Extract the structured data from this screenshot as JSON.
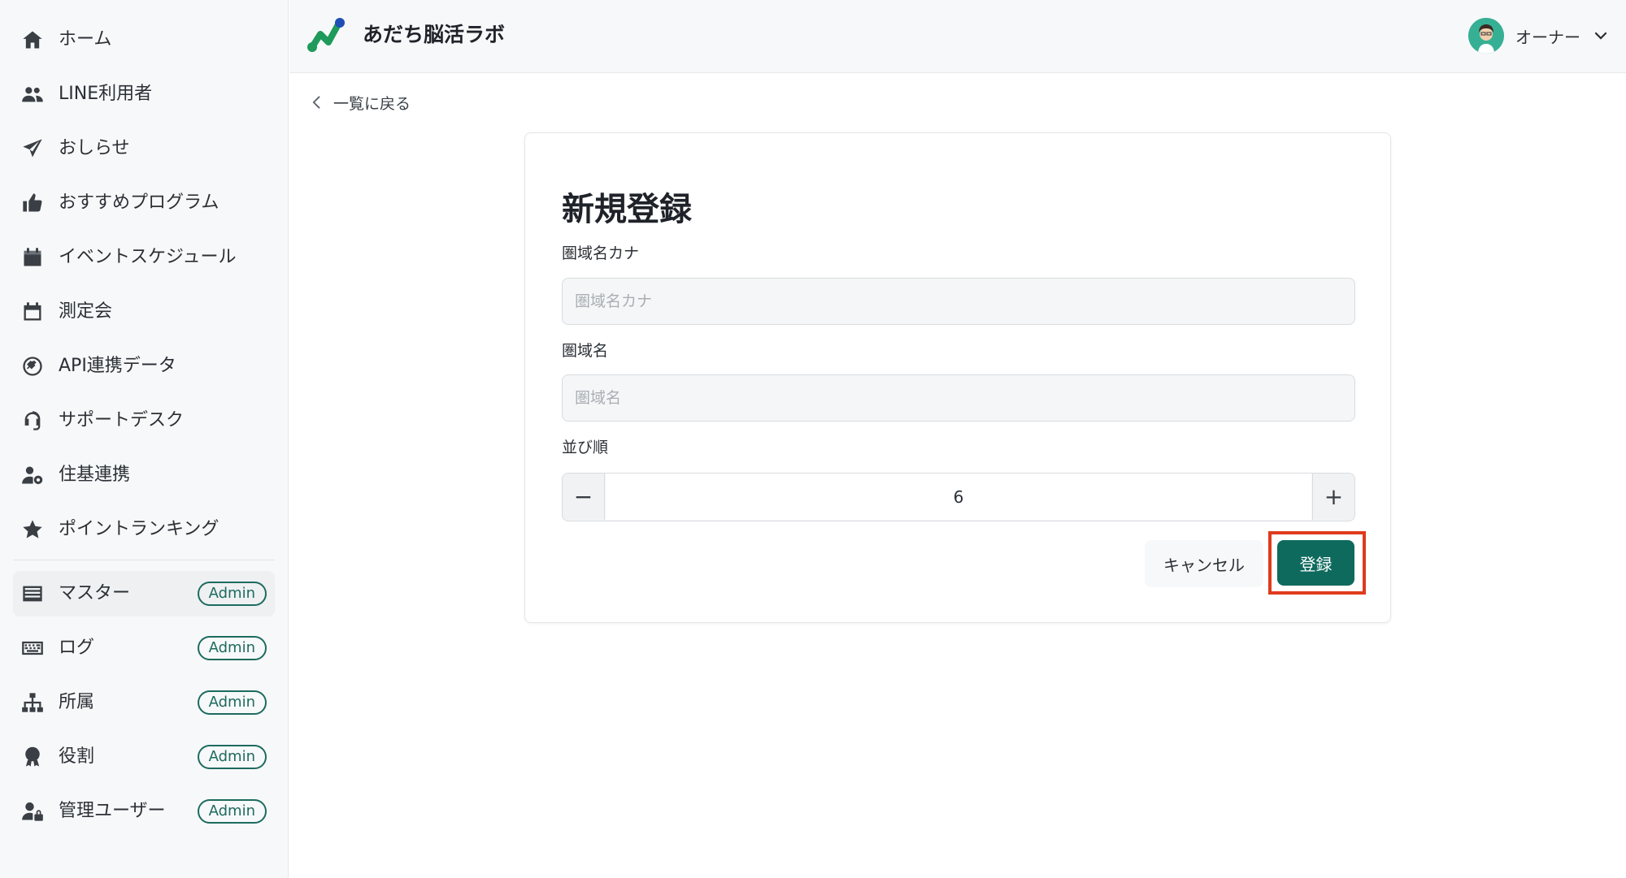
{
  "colors": {
    "accent": "#0f6a5e",
    "badge": "#1d6b5f",
    "highlight": "#e03a1e",
    "sidebar_bg": "#f7f8f9"
  },
  "sidebar": {
    "items": [
      {
        "label": "ホーム",
        "icon": "home-icon"
      },
      {
        "label": "LINE利用者",
        "icon": "users-icon"
      },
      {
        "label": "おしらせ",
        "icon": "paper-plane-icon"
      },
      {
        "label": "おすすめプログラム",
        "icon": "thumbs-up-icon"
      },
      {
        "label": "イベントスケジュール",
        "icon": "calendar-icon"
      },
      {
        "label": "測定会",
        "icon": "calendar-outline-icon"
      },
      {
        "label": "API連携データ",
        "icon": "plug-icon"
      },
      {
        "label": "サポートデスク",
        "icon": "headset-icon"
      },
      {
        "label": "住基連携",
        "icon": "user-gear-icon"
      },
      {
        "label": "ポイントランキング",
        "icon": "star-icon"
      },
      {
        "label": "マスター",
        "icon": "list-icon",
        "badge": "Admin"
      },
      {
        "label": "ログ",
        "icon": "keyboard-icon",
        "badge": "Admin"
      },
      {
        "label": "所属",
        "icon": "sitemap-icon",
        "badge": "Admin"
      },
      {
        "label": "役割",
        "icon": "award-icon",
        "badge": "Admin"
      },
      {
        "label": "管理ユーザー",
        "icon": "user-lock-icon",
        "badge": "Admin"
      }
    ]
  },
  "header": {
    "title": "あだち脳活ラボ",
    "user_name": "オーナー"
  },
  "main": {
    "back_label": "一覧に戻る",
    "form": {
      "title": "新規登録",
      "fields": {
        "kana_label": "圏域名カナ",
        "kana_placeholder": "圏域名カナ",
        "name_label": "圏域名",
        "name_placeholder": "圏域名",
        "order_label": "並び順",
        "order_value": "6",
        "minus": "−",
        "plus": "+"
      },
      "cancel_label": "キャンセル",
      "submit_label": "登録"
    }
  }
}
